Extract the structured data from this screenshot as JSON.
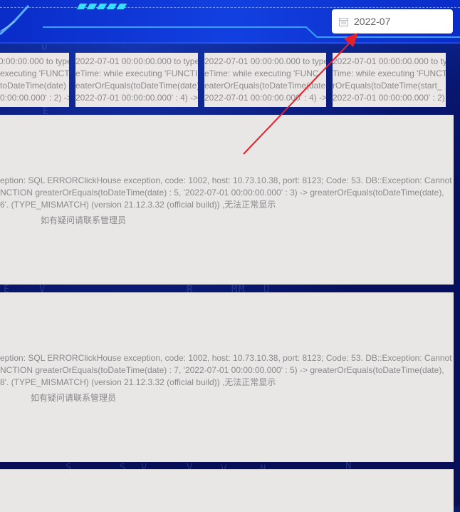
{
  "date_picker": {
    "value": "2022-07",
    "icon": "calendar-icon"
  },
  "tiles": [
    {
      "lines": [
        "0:00:00.000 to type",
        "executing 'FUNCTI",
        "toDateTime(date)",
        "0:00:00.000' : 2) ->"
      ]
    },
    {
      "lines": [
        "2022-07-01 00:00:00.000 to type",
        "eTime: while executing 'FUNCTI",
        "eaterOrEquals(toDateTime(date)",
        "2022-07-01 00:00:00.000' : 4) ->"
      ]
    },
    {
      "lines": [
        "2022-07-01 00:00:00.000 to type",
        "eTime: while executing 'FUNC",
        "eaterOrEquals(toDateTime(date)",
        "2022-07-01 00:00:00.000' : 4) ->"
      ]
    },
    {
      "lines": [
        "2022-07-01 00:00:00.000 to typ",
        "Time: while executing 'FUNCTI",
        "rOrEquals(toDateTime(start_",
        "2022-07-01 00:00:00.000' : 2)"
      ]
    }
  ],
  "panels": [
    {
      "lines": [
        "eption: SQL ERRORClickHouse exception, code: 1002, host: 10.73.10.38, port: 8123; Code: 53. DB::Exception: Cannot",
        "NCTION greaterOrEquals(toDateTime(date) : 5, '2022-07-01 00:00:00.000' : 3) -> greaterOrEquals(toDateTime(date),",
        "6'. (TYPE_MISMATCH) (version 21.12.3.32 (official build)) ,无法正常显示"
      ],
      "contact": "如有疑问请联系管理员"
    },
    {
      "lines": [
        "eption: SQL ERRORClickHouse exception, code: 1002, host: 10.73.10.38, port: 8123; Code: 53. DB::Exception: Cannot",
        "NCTION greaterOrEquals(toDateTime(date) : 7, '2022-07-01 00:00:00.000' : 5) -> greaterOrEquals(toDateTime(date),",
        "8'. (TYPE_MISMATCH) (version 21.12.3.32 (official build)) ,无法正常显示"
      ],
      "contact": "如有疑问请联系管理员"
    },
    {
      "lines": [],
      "contact": ""
    }
  ],
  "background_glyphs": [
    "S",
    "U",
    "R",
    "V",
    "E",
    "M",
    "E",
    "V",
    "R",
    "V",
    "M",
    "U",
    "S",
    "V",
    "V",
    "N",
    "S",
    "N"
  ],
  "colors": {
    "accent": "#1240e0",
    "arrow": "#e8202a",
    "panel": "#e9e6e6"
  }
}
